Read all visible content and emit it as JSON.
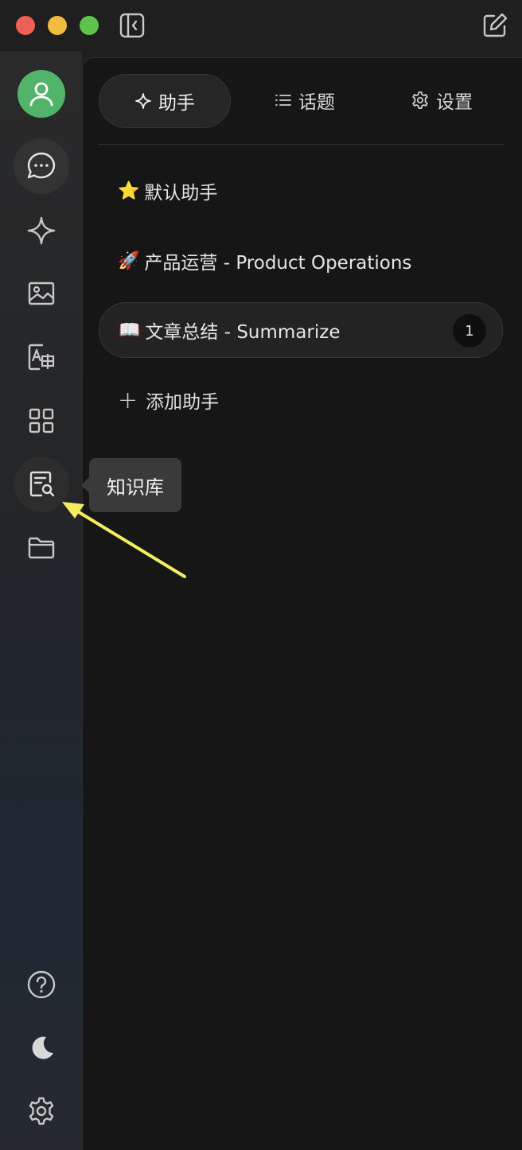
{
  "tabs": [
    {
      "label": "助手",
      "icon": "sparkle-icon",
      "active": true
    },
    {
      "label": "话题",
      "icon": "list-icon",
      "active": false
    },
    {
      "label": "设置",
      "icon": "gear-icon",
      "active": false
    }
  ],
  "assistants": [
    {
      "emoji": "⭐",
      "label": "默认助手"
    },
    {
      "emoji": "🚀",
      "label": "产品运营 - Product Operations"
    },
    {
      "emoji": "📖",
      "label": "文章总结 - Summarize",
      "count": "1",
      "selected": true
    }
  ],
  "add_assistant_label": "添加助手",
  "tooltip": "知识库",
  "rail_icons": [
    "user-avatar-icon",
    "chat-icon",
    "sparkle-icon",
    "image-icon",
    "translate-icon",
    "apps-grid-icon",
    "knowledge-base-icon",
    "folder-icon",
    "help-icon",
    "moon-icon",
    "gear-icon"
  ],
  "colors": {
    "avatar": "#52b46a",
    "annotation_arrow": "#f4ee5c",
    "close": "#ee5f57",
    "minimize": "#f2bc3f",
    "maximize": "#5fc44c"
  }
}
